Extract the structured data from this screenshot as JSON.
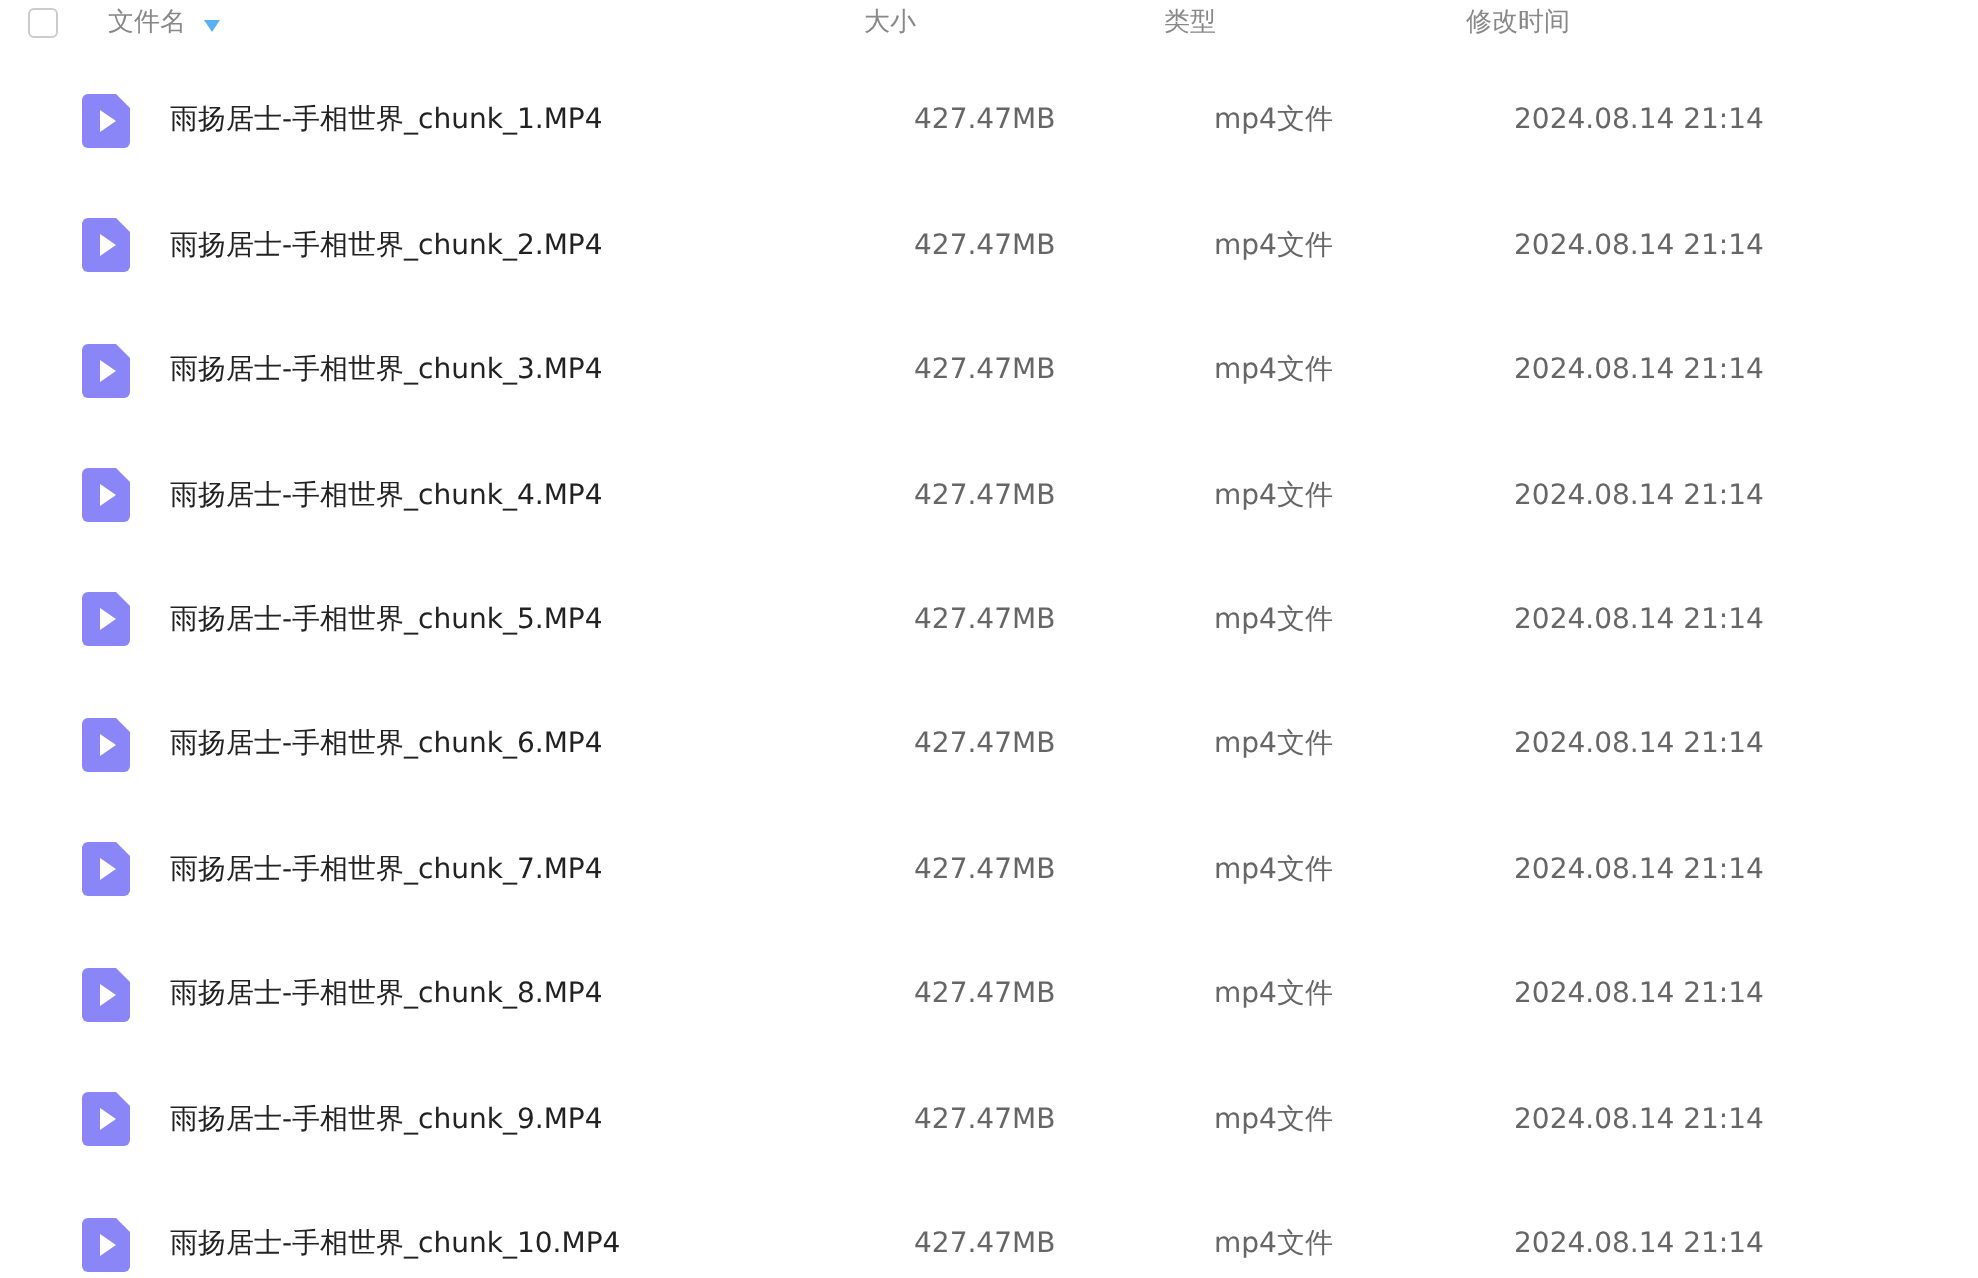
{
  "header": {
    "checked": false,
    "columns": [
      "文件名",
      "大小",
      "类型",
      "修改时间"
    ]
  },
  "rows": [
    {
      "name": "雨扬居士-手相世界_chunk_1.MP4",
      "size": "427.47MB",
      "type": "mp4文件",
      "modified": "2024.08.14 21:14"
    },
    {
      "name": "雨扬居士-手相世界_chunk_2.MP4",
      "size": "427.47MB",
      "type": "mp4文件",
      "modified": "2024.08.14 21:14"
    },
    {
      "name": "雨扬居士-手相世界_chunk_3.MP4",
      "size": "427.47MB",
      "type": "mp4文件",
      "modified": "2024.08.14 21:14"
    },
    {
      "name": "雨扬居士-手相世界_chunk_4.MP4",
      "size": "427.47MB",
      "type": "mp4文件",
      "modified": "2024.08.14 21:14"
    },
    {
      "name": "雨扬居士-手相世界_chunk_5.MP4",
      "size": "427.47MB",
      "type": "mp4文件",
      "modified": "2024.08.14 21:14"
    },
    {
      "name": "雨扬居士-手相世界_chunk_6.MP4",
      "size": "427.47MB",
      "type": "mp4文件",
      "modified": "2024.08.14 21:14"
    },
    {
      "name": "雨扬居士-手相世界_chunk_7.MP4",
      "size": "427.47MB",
      "type": "mp4文件",
      "modified": "2024.08.14 21:14"
    },
    {
      "name": "雨扬居士-手相世界_chunk_8.MP4",
      "size": "427.47MB",
      "type": "mp4文件",
      "modified": "2024.08.14 21:14"
    },
    {
      "name": "雨扬居士-手相世界_chunk_9.MP4",
      "size": "427.47MB",
      "type": "mp4文件",
      "modified": "2024.08.14 21:14"
    },
    {
      "name": "雨扬居士-手相世界_chunk_10.MP4",
      "size": "427.47MB",
      "type": "mp4文件",
      "modified": "2024.08.14 21:14"
    }
  ]
}
